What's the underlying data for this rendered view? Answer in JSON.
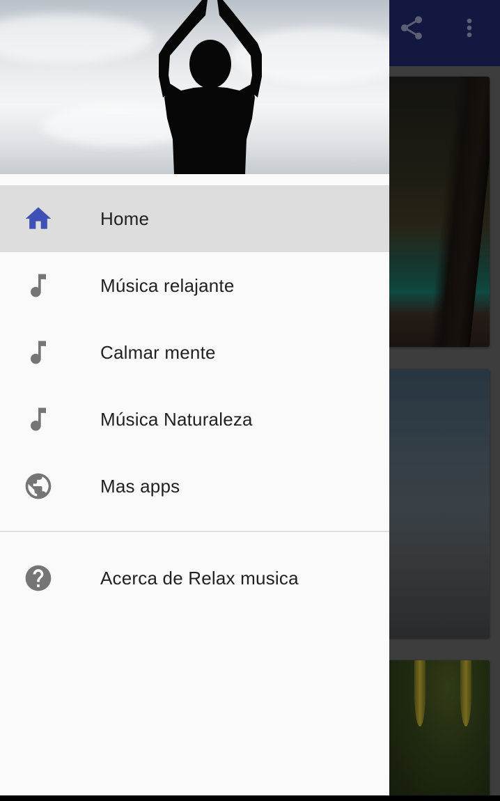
{
  "toolbar": {
    "share_icon": "share-icon",
    "more_icon": "more-vert-icon"
  },
  "drawer": {
    "header_image": "yoga silhouette against sky",
    "items": [
      {
        "label": "Home",
        "icon": "home-icon",
        "active": true
      },
      {
        "label": "Música relajante",
        "icon": "music-note-icon",
        "active": false
      },
      {
        "label": "Calmar mente",
        "icon": "music-note-icon",
        "active": false
      },
      {
        "label": "Música Naturaleza",
        "icon": "music-note-icon",
        "active": false
      },
      {
        "label": "Mas apps",
        "icon": "globe-icon",
        "active": false
      }
    ],
    "about": {
      "label": "Acerca de Relax musica",
      "icon": "help-icon"
    }
  },
  "colors": {
    "toolbar": "#1d2563",
    "active_icon": "#3f51b5",
    "inactive_icon": "#757575",
    "active_row": "#dddddd",
    "drawer_bg": "#fafafa"
  }
}
